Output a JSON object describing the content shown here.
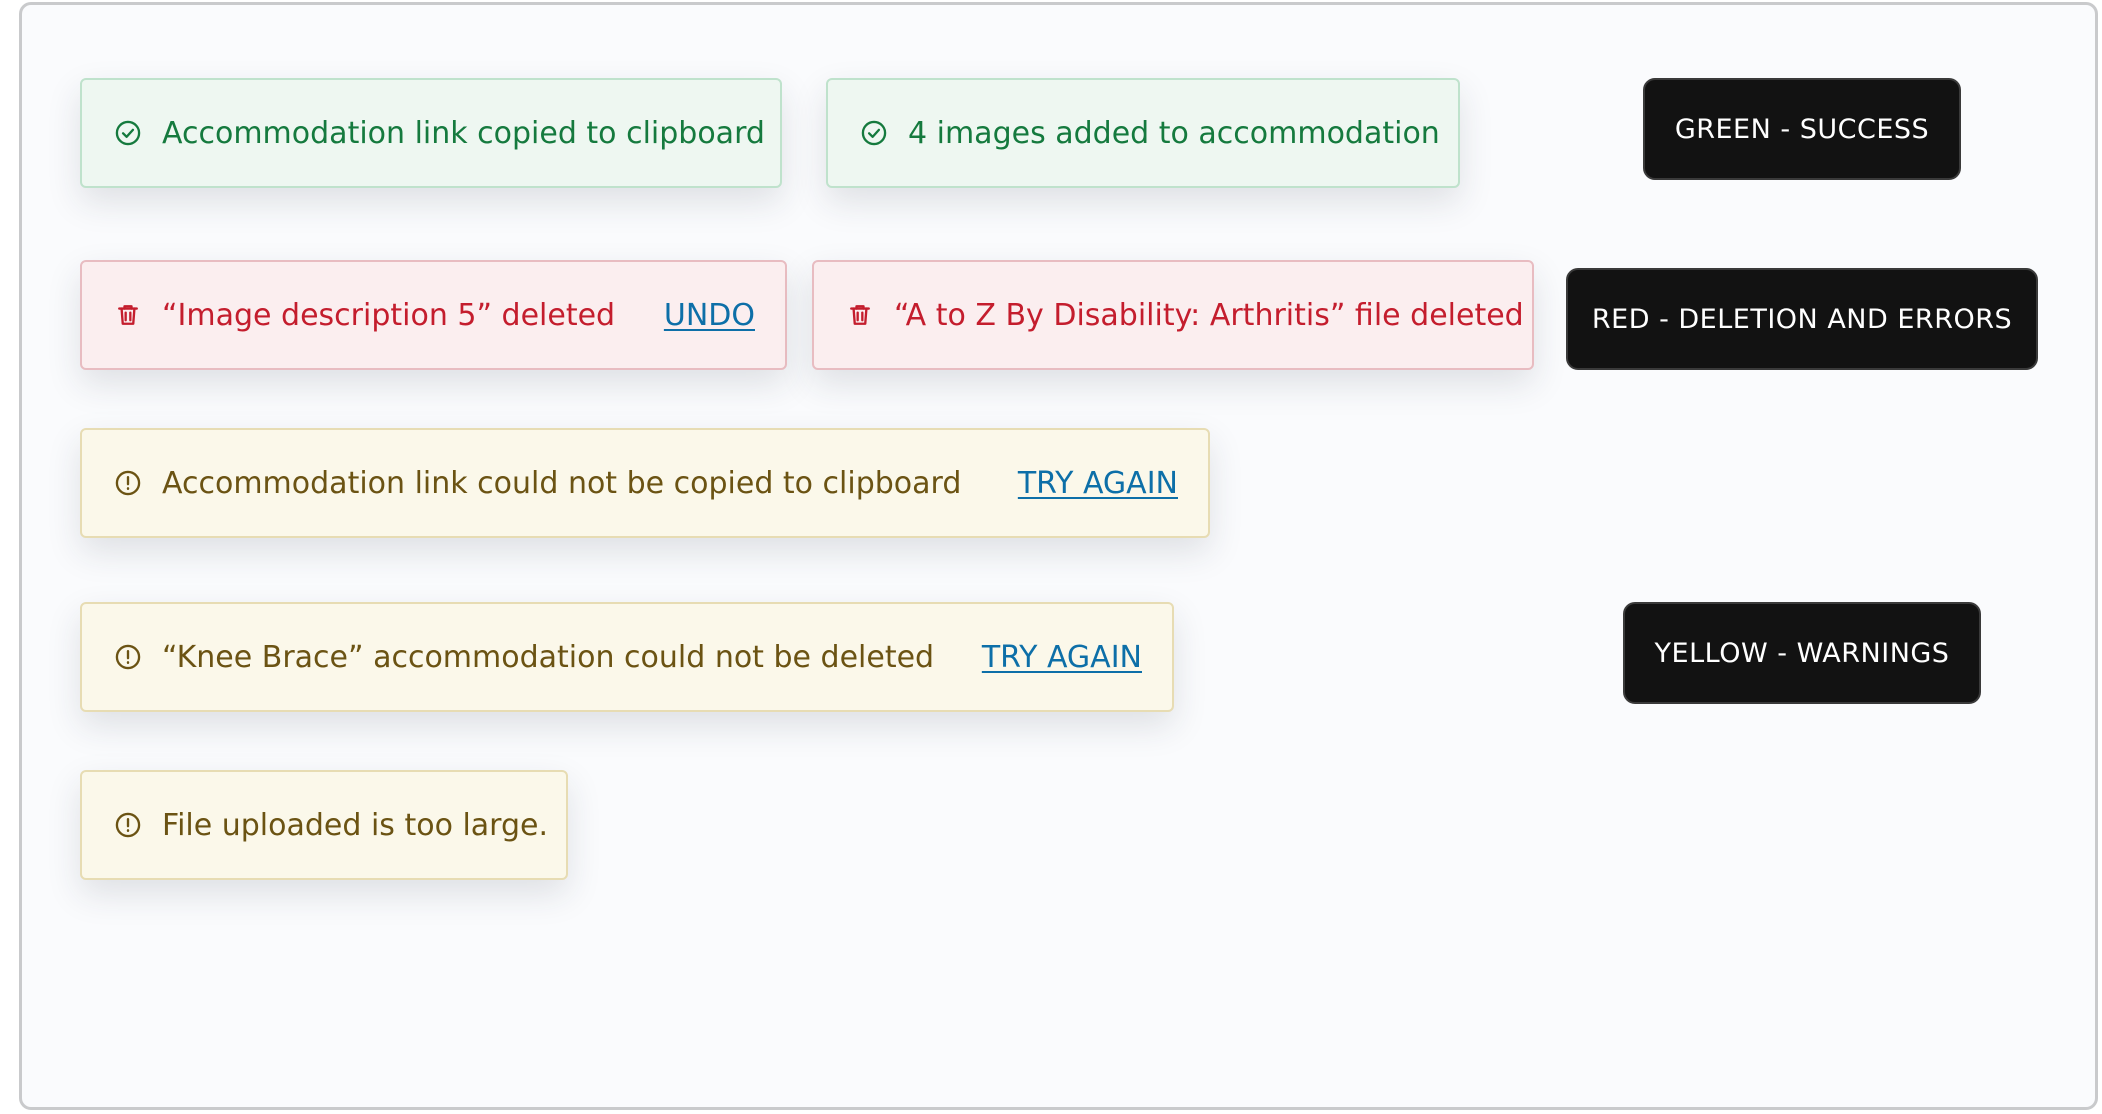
{
  "toasts": {
    "success_copy": {
      "icon": "check-circle-icon",
      "message": "Accommodation link copied to clipboard"
    },
    "success_images": {
      "icon": "check-circle-icon",
      "message": "4 images added to accommodation"
    },
    "danger_image_deleted": {
      "icon": "trash-icon",
      "message": "“Image description 5” deleted",
      "action": "UNDO"
    },
    "danger_file_deleted": {
      "icon": "trash-icon",
      "message": "“A to Z By Disability: Arthritis” file deleted"
    },
    "warning_copy_failed": {
      "icon": "alert-circle-icon",
      "message": "Accommodation link could not be copied to clipboard",
      "action": "TRY AGAIN"
    },
    "warning_delete_failed": {
      "icon": "alert-circle-icon",
      "message": "“Knee Brace” accommodation could not be deleted",
      "action": "TRY AGAIN"
    },
    "warning_file_large": {
      "icon": "alert-circle-icon",
      "message": "File uploaded is too large."
    }
  },
  "category_labels": {
    "green": "GREEN - SUCCESS",
    "red": "RED - DELETION AND ERRORS",
    "yellow": "YELLOW - WARNINGS"
  },
  "colors": {
    "success_text": "#157a3e",
    "success_bg": "#eef7f1",
    "danger_text": "#c41d2d",
    "danger_bg": "#fbeeef",
    "warning_text": "#6b5313",
    "warning_bg": "#fbf8ea",
    "action_link": "#0d6fa8",
    "label_bg": "#121212"
  }
}
